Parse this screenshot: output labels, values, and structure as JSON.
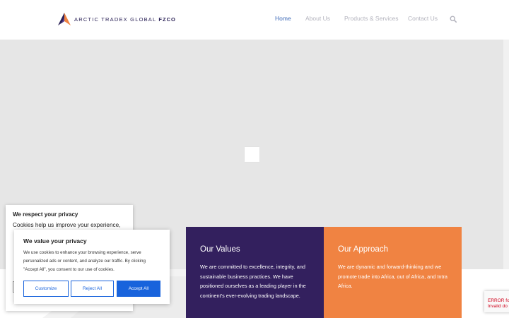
{
  "header": {
    "logo": {
      "name": "ARCTIC TRADEX GLOBAL",
      "suffix": "FZCO",
      "colors": {
        "navy": "#2b2257",
        "orange": "#f08342",
        "purple": "#5a3e8f"
      }
    },
    "nav": [
      {
        "label": "Home",
        "active": true
      },
      {
        "label": "About Us",
        "active": false
      },
      {
        "label": "Products & Services",
        "active": false
      },
      {
        "label": "Contact Us",
        "active": false
      }
    ],
    "search_icon": "search-icon"
  },
  "hero": {
    "background": "#e6e6e6"
  },
  "cards": [
    {
      "title": "Our Values",
      "text": "We are committed to excellence, integrity, and sustainable business practices. We have positioned ourselves as a leading player in the continent’s ever-evolving trading landscape.",
      "color": "#33205e"
    },
    {
      "title": "Our Approach",
      "text": "We are dynamic and forward-thinking and we promote trade into Africa, out of Africa, and Intra Africa.",
      "color": "#f08342"
    }
  ],
  "cookie_back": {
    "title": "We respect your privacy",
    "text": "Cookies help us improve your experience,"
  },
  "cookie_front": {
    "title": "We value your privacy",
    "text": "We use cookies to enhance your browsing experience, serve personalized ads or content, and analyze our traffic. By clicking \"Accept All\", you consent to our use of cookies.",
    "buttons": {
      "customize": "Customize",
      "reject": "Reject All",
      "accept": "Accept All"
    },
    "accent": "#1863dc"
  },
  "recaptcha": {
    "line1": "ERROR fo",
    "line2": "Invalid do"
  }
}
